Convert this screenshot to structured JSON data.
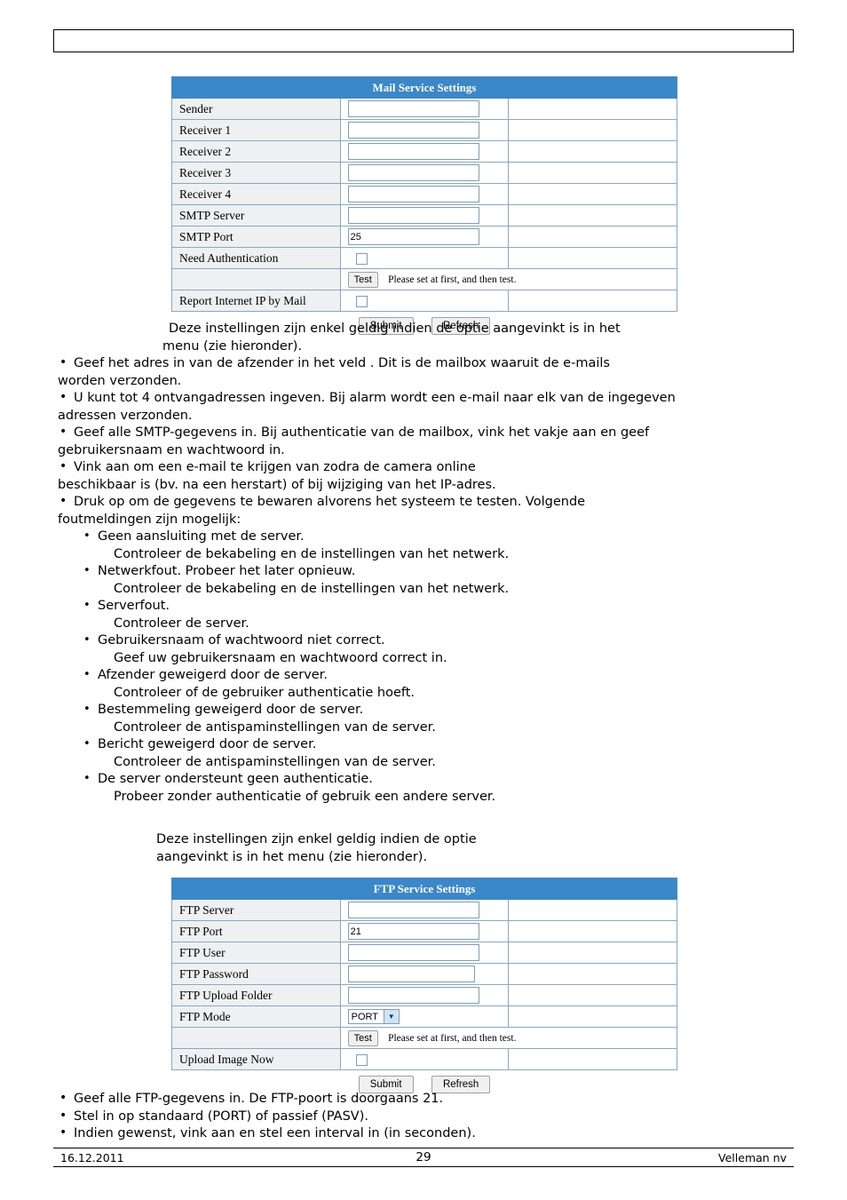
{
  "mail_table": {
    "title": "Mail Service Settings",
    "rows": [
      {
        "label": "Sender",
        "type": "text",
        "value": ""
      },
      {
        "label": "Receiver 1",
        "type": "text",
        "value": ""
      },
      {
        "label": "Receiver 2",
        "type": "text",
        "value": ""
      },
      {
        "label": "Receiver 3",
        "type": "text",
        "value": ""
      },
      {
        "label": "Receiver 4",
        "type": "text",
        "value": ""
      },
      {
        "label": "SMTP Server",
        "type": "text",
        "value": ""
      },
      {
        "label": "SMTP Port",
        "type": "text",
        "value": "25"
      },
      {
        "label": "Need Authentication",
        "type": "checkbox",
        "checked": false
      },
      {
        "label": "",
        "type": "test",
        "button": "Test",
        "note": "Please set at first, and then test."
      },
      {
        "label": "Report Internet IP by Mail",
        "type": "checkbox",
        "checked": false
      }
    ],
    "submit_label": "Submit",
    "refresh_label": "Refresh"
  },
  "ftp_table": {
    "title": "FTP Service Settings",
    "rows": [
      {
        "label": "FTP Server",
        "type": "text",
        "value": ""
      },
      {
        "label": "FTP Port",
        "type": "text",
        "value": "21"
      },
      {
        "label": "FTP User",
        "type": "text",
        "value": ""
      },
      {
        "label": "FTP Password",
        "type": "password",
        "value": ""
      },
      {
        "label": "FTP Upload Folder",
        "type": "text",
        "value": ""
      },
      {
        "label": "FTP Mode",
        "type": "select",
        "value": "PORT"
      },
      {
        "label": "",
        "type": "test",
        "button": "Test",
        "note": "Please set at first, and then test."
      },
      {
        "label": "Upload Image Now",
        "type": "checkbox",
        "checked": false
      }
    ],
    "submit_label": "Submit",
    "refresh_label": "Refresh"
  },
  "mail_intro": {
    "line1": "Deze instellingen zijn enkel geldig indien de optie                        aangevinkt is in het",
    "line2": "menu                                   (zie hieronder)."
  },
  "mail_bullets": [
    {
      "lines": [
        "Geef het adres in van de afzender in het veld           . Dit is de mailbox waaruit de e-mails",
        "worden verzonden."
      ]
    },
    {
      "lines": [
        "U kunt tot 4 ontvangadressen ingeven. Bij alarm wordt een e-mail naar elk van de ingegeven",
        "adressen verzonden."
      ]
    },
    {
      "lines": [
        "Geef alle SMTP-gegevens in. Bij authenticatie van de mailbox, vink het vakje aan en geef",
        "gebruikersnaam en wachtwoord in."
      ]
    },
    {
      "lines": [
        "Vink                                       aan om een e-mail te krijgen van zodra de camera online",
        "beschikbaar is (bv. na een herstart) of bij wijziging van het IP-adres."
      ]
    },
    {
      "lines": [
        "Druk op                om de gegevens te bewaren alvorens het systeem te testen. Volgende",
        "foutmeldingen zijn mogelijk:"
      ]
    }
  ],
  "error_bullets": [
    {
      "main": "Geen aansluiting met de server.",
      "sub": "Controleer de bekabeling en de instellingen van het netwerk."
    },
    {
      "main": "Netwerkfout. Probeer het later opnieuw.",
      "sub": "Controleer de bekabeling en de instellingen van het netwerk."
    },
    {
      "main": "Serverfout.",
      "sub": "Controleer de server."
    },
    {
      "main": "Gebruikersnaam of wachtwoord niet correct.",
      "sub": "Geef uw gebruikersnaam en wachtwoord correct in."
    },
    {
      "main": "Afzender geweigerd door de server.",
      "sub": "Controleer of de gebruiker authenticatie hoeft."
    },
    {
      "main": "Bestemmeling geweigerd door de server.",
      "sub": "Controleer de antispaminstellingen van de server."
    },
    {
      "main": "Bericht geweigerd door de server.",
      "sub": "Controleer de antispaminstellingen van de server."
    },
    {
      "main": "De server ondersteunt geen authenticatie.",
      "sub": "Probeer zonder authenticatie of gebruik een andere server."
    }
  ],
  "ftp_intro": {
    "line1": "Deze instellingen zijn enkel geldig indien de optie",
    "line2": "aangevinkt is in het menu                                     (zie hieronder)."
  },
  "ftp_bullets": [
    "Geef alle FTP-gegevens in. De FTP-poort is doorgaans 21.",
    "Stel                in op standaard (PORT) of passief (PASV).",
    "Indien gewenst, vink                             aan en stel een interval in (in seconden)."
  ],
  "footer": {
    "date": "16.12.2011",
    "page": "29",
    "company": "Velleman nv"
  }
}
